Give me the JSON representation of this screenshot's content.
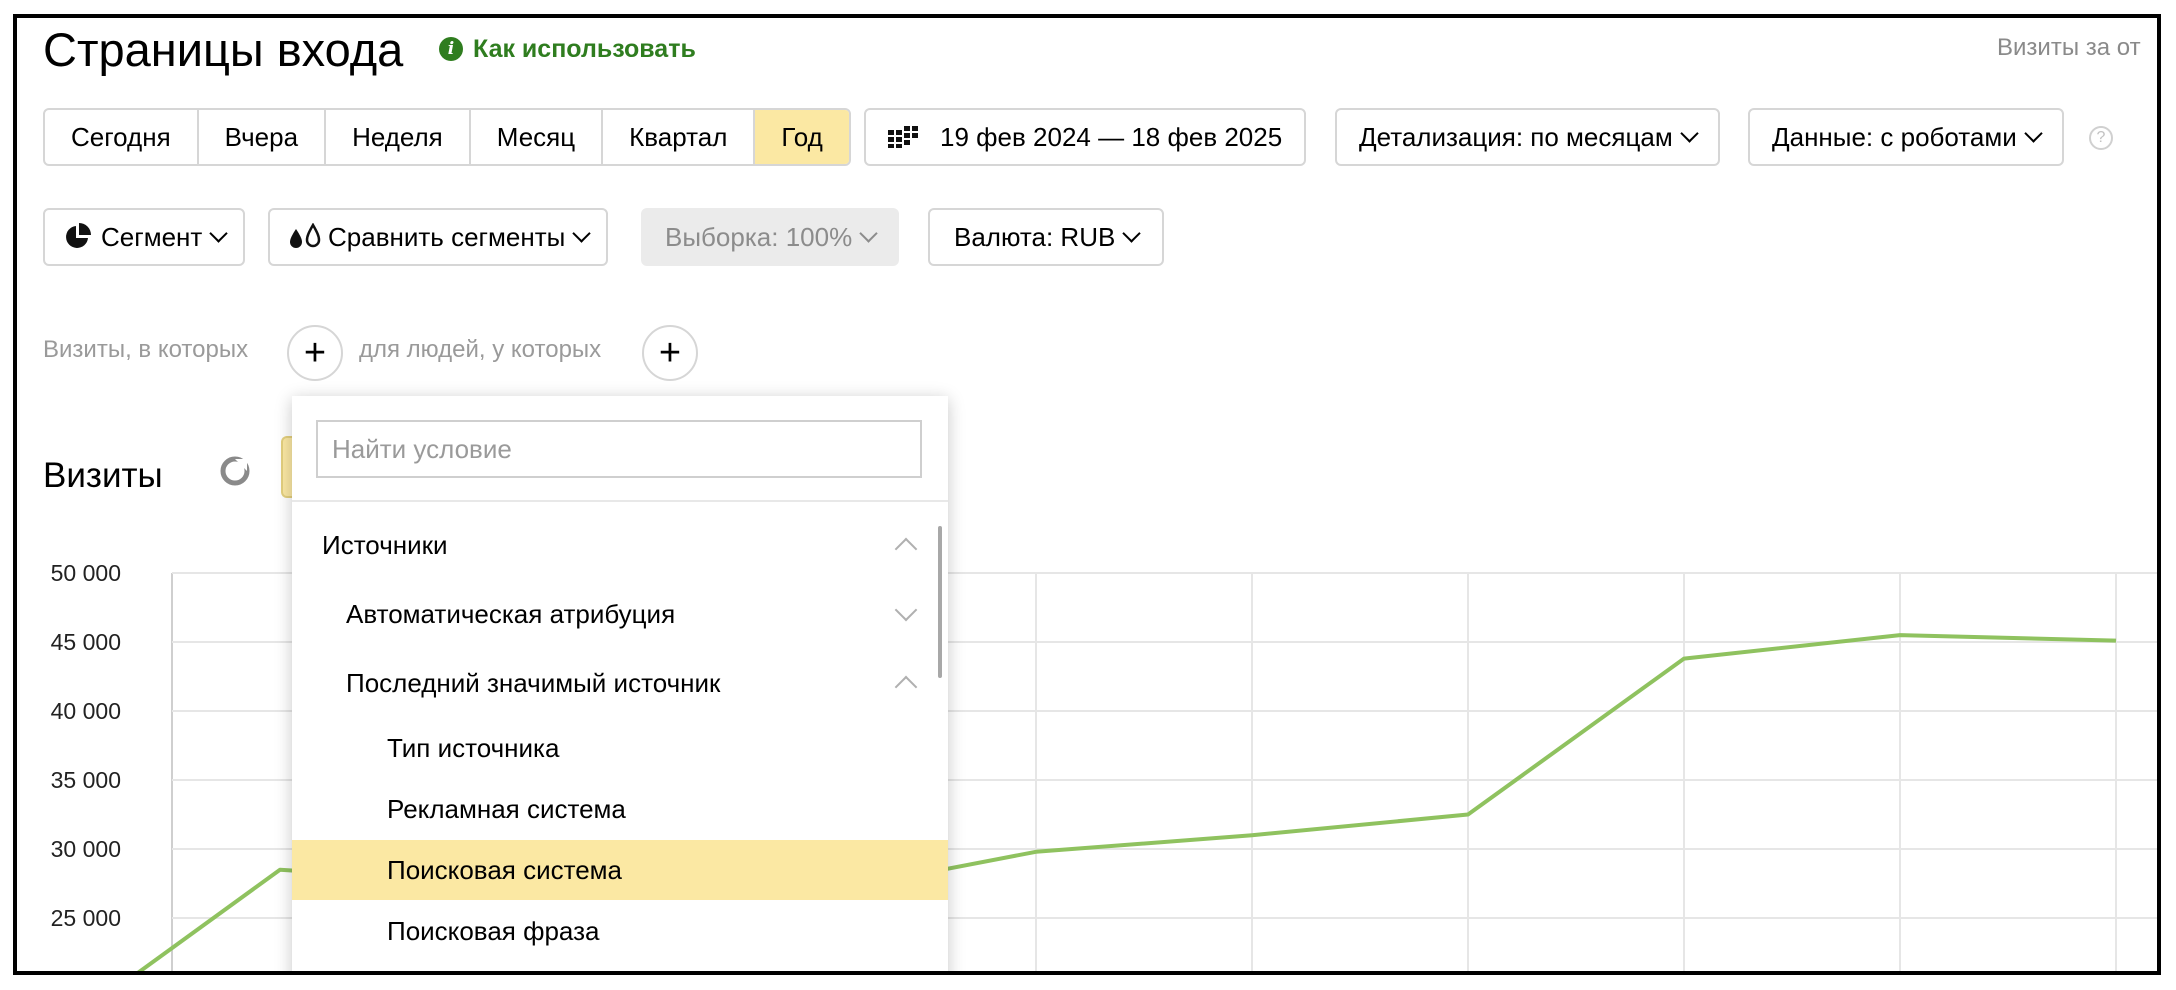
{
  "header": {
    "title": "Страницы входа",
    "how_to_use": "Как использовать",
    "visits_for": "Визиты за от"
  },
  "periods": [
    "Сегодня",
    "Вчера",
    "Неделя",
    "Месяц",
    "Квартал",
    "Год"
  ],
  "active_period": "Год",
  "date_range": "19 фев 2024 — 18 фев 2025",
  "detail_button": "Детализация: по месяцам",
  "data_button": "Данные: с роботами",
  "segment_button": "Сегмент",
  "compare_button": "Сравнить сегменты",
  "sample_button": "Выборка: 100%",
  "currency_button": "Валюта: RUB",
  "conditions": {
    "visits_label": "Визиты, в которых",
    "people_label": "для людей, у которых"
  },
  "section_title": "Визиты",
  "dropdown": {
    "search_placeholder": "Найти условие",
    "items": [
      {
        "label": "Источники",
        "level": 0,
        "arrow": "up"
      },
      {
        "label": "Автоматическая атрибуция",
        "level": 1,
        "arrow": "down"
      },
      {
        "label": "Последний значимый источник",
        "level": 1,
        "arrow": "up"
      },
      {
        "label": "Тип источника",
        "level": 2
      },
      {
        "label": "Рекламная система",
        "level": 2
      },
      {
        "label": "Поисковая система",
        "level": 2,
        "highlighted": true
      },
      {
        "label": "Поисковая фраза",
        "level": 2
      }
    ]
  },
  "colors": {
    "accent": "#fbe8a3",
    "link": "#2f7d1f",
    "line": "#8fc25f"
  },
  "chart_data": {
    "type": "line",
    "yticks": [
      "50 000",
      "45 000",
      "40 000",
      "35 000",
      "30 000",
      "25 000"
    ],
    "ylim": [
      21000,
      50000
    ],
    "grid": true,
    "series": [
      {
        "x": [
          -0.16,
          0.5,
          1,
          2,
          3,
          4,
          5,
          6,
          7,
          8,
          9
        ],
        "values": [
          21000,
          28500,
          28000,
          27500,
          26800,
          29800,
          31000,
          32500,
          43800,
          45500,
          45100
        ]
      }
    ]
  }
}
